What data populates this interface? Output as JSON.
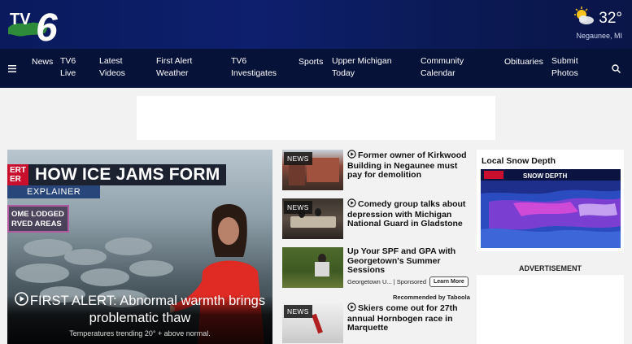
{
  "header": {
    "logo_alt": "TV6",
    "weather": {
      "temp": "32°",
      "location": "Negaunee, MI",
      "icon": "partly-cloudy-icon"
    }
  },
  "nav": {
    "items": [
      {
        "label": "News"
      },
      {
        "label": "TV6 Live"
      },
      {
        "label": "Latest Videos"
      },
      {
        "label": "First Alert Weather"
      },
      {
        "label": "TV6 Investigates"
      },
      {
        "label": "Sports"
      },
      {
        "label": "Upper Michigan Today"
      },
      {
        "label": "Community Calendar"
      },
      {
        "label": "Obituaries"
      },
      {
        "label": "Submit Photos"
      }
    ]
  },
  "hero": {
    "banner_red": "ERT\nER",
    "banner_title": "HOW ICE JAMS FORM",
    "explainer": "EXPLAINER",
    "lodged": "OME LODGED\nRVED AREAS",
    "headline": "FIRST ALERT: Abnormal warmth brings problematic thaw",
    "sub": "Temperatures trending 20° + above normal."
  },
  "stories": [
    {
      "tag": "NEWS",
      "title": "Former owner of Kirkwood Building in Negaunee must pay for demolition",
      "play": true
    },
    {
      "tag": "NEWS",
      "title": "Comedy group talks about depression with Michigan National Guard in Gladstone",
      "play": true
    },
    {
      "tag": "",
      "title": "Up Your SPF and GPA with Georgetown's Summer Sessions",
      "play": false
    },
    {
      "tag": "NEWS",
      "title": "Skiers come out for 27th annual Hornbogen race in Marquette",
      "play": true
    }
  ],
  "sponsored": {
    "source": "Georgetown U...",
    "label": "Sponsored",
    "button": "Learn More",
    "recommended": "Recommended by Taboola"
  },
  "sidebar": {
    "snow_title": "Local Snow Depth",
    "map_label": "SNOW DEPTH",
    "advertisement": "ADVERTISEMENT"
  },
  "colors": {
    "header_bg": "#0e1f6e",
    "nav_bg": "#071238",
    "accent_red": "#c8102e",
    "logo_green": "#2e7d32"
  }
}
